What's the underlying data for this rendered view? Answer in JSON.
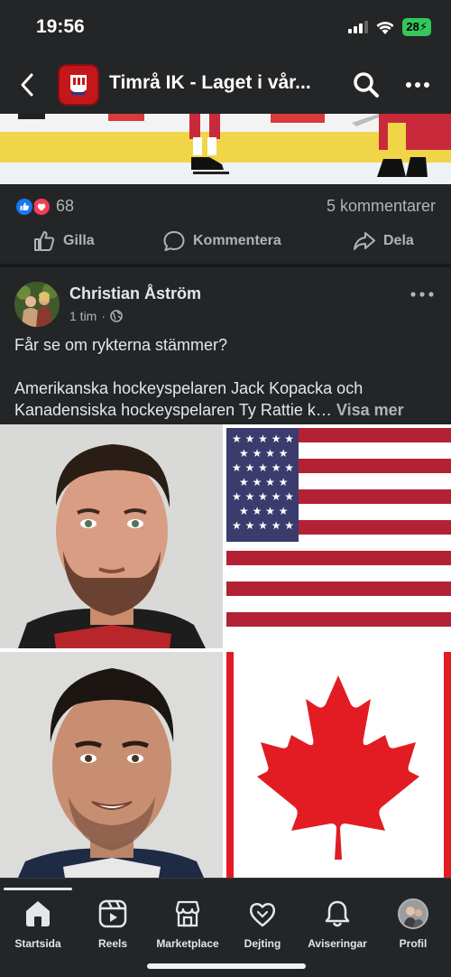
{
  "status_bar": {
    "time": "19:56",
    "battery": "28"
  },
  "nav": {
    "title": "Timrå IK - Laget i vår..."
  },
  "reactions": {
    "count": "68",
    "comments": "5 kommentarer"
  },
  "actions": {
    "like": "Gilla",
    "comment": "Kommentera",
    "share": "Dela"
  },
  "post": {
    "author": "Christian Åström",
    "time": "1 tim",
    "line1": "Får se om rykterna stämmer?",
    "line2": "Amerikanska hockeyspelaren Jack Kopacka och",
    "line3": "Kanadensiska hockeyspelaren Ty Rattie k…",
    "see_more": "Visa mer"
  },
  "tabs": [
    {
      "label": "Startsida",
      "icon": "home-icon"
    },
    {
      "label": "Reels",
      "icon": "reels-icon"
    },
    {
      "label": "Marketplace",
      "icon": "marketplace-icon"
    },
    {
      "label": "Dejting",
      "icon": "dating-icon"
    },
    {
      "label": "Aviseringar",
      "icon": "bell-icon"
    },
    {
      "label": "Profil",
      "icon": "profile-icon"
    }
  ],
  "colors": {
    "background": "#242526",
    "text": "#e4e6eb",
    "secondary_text": "#b0b3b8",
    "like_blue": "#1877f2",
    "love_red": "#f33e58"
  }
}
